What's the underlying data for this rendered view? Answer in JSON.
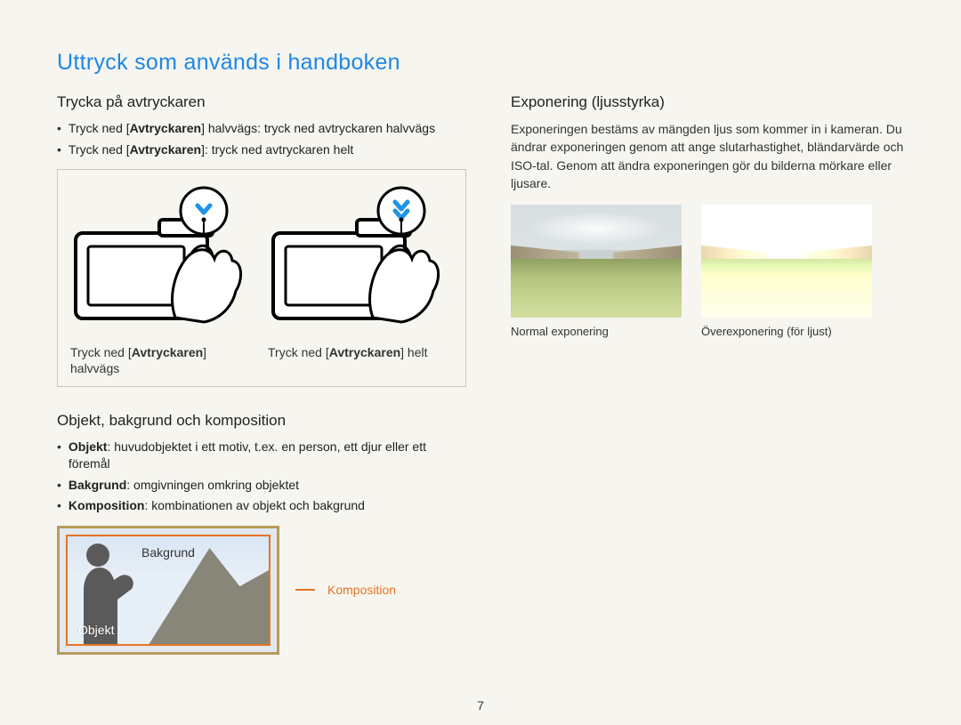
{
  "title": "Uttryck som används i handboken",
  "pageNumber": "7",
  "sections": {
    "shutter": {
      "heading": "Trycka på avtryckaren",
      "bullet1_pre": "Tryck ned [",
      "bullet1_b": "Avtryckaren",
      "bullet1_post": "] halvvägs: tryck ned avtryckaren halvvägs",
      "bullet2_pre": "Tryck ned [",
      "bullet2_b": "Avtryckaren",
      "bullet2_post": "]: tryck ned avtryckaren helt",
      "cap1_pre": "Tryck ned [",
      "cap1_b": "Avtryckaren",
      "cap1_post": "] halvvägs",
      "cap2_pre": "Tryck ned [",
      "cap2_b": "Avtryckaren",
      "cap2_post": "] helt"
    },
    "composition": {
      "heading": "Objekt, bakgrund och komposition",
      "b1_b": "Objekt",
      "b1_t": ": huvudobjektet i ett motiv, t.ex. en person, ett djur eller ett föremål",
      "b2_b": "Bakgrund",
      "b2_t": ": omgivningen omkring objektet",
      "b3_b": "Komposition",
      "b3_t": ": kombinationen av objekt och bakgrund",
      "label_bakgrund": "Bakgrund",
      "label_objekt": "Objekt",
      "label_komposition": "Komposition"
    },
    "exposure": {
      "heading": "Exponering (ljusstyrka)",
      "body": "Exponeringen bestäms av mängden ljus som kommer in i kameran. Du ändrar exponeringen genom att ange slutarhastighet, bländarvärde och ISO-tal. Genom att ändra exponeringen gör du bilderna mörkare eller ljusare.",
      "cap_normal": "Normal exponering",
      "cap_over": "Överexponering (för ljust)"
    }
  }
}
